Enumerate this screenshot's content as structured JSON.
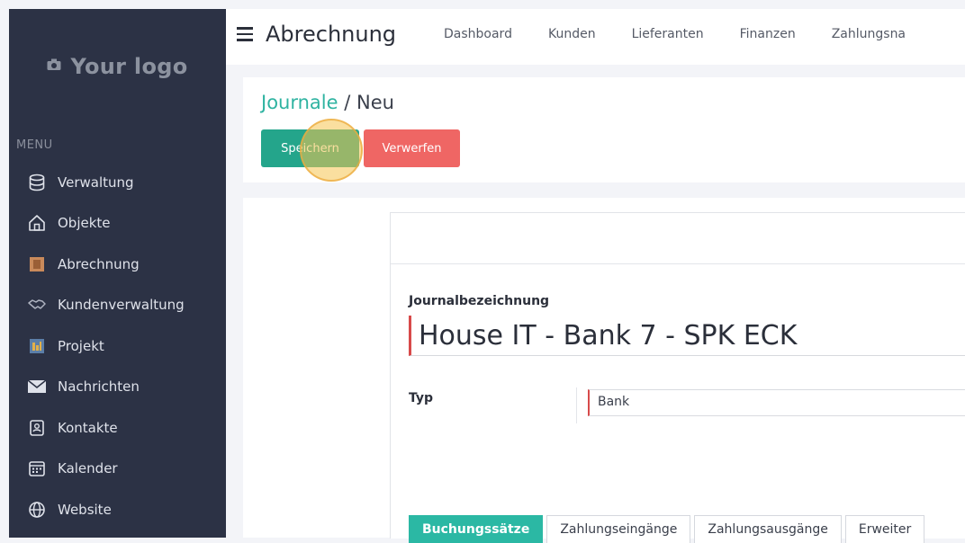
{
  "sidebar": {
    "logo_text": "Your logo",
    "menu_label": "MENU",
    "items": [
      {
        "label": "Verwaltung",
        "icon": "database-icon"
      },
      {
        "label": "Objekte",
        "icon": "house-icon"
      },
      {
        "label": "Abrechnung",
        "icon": "invoice-icon"
      },
      {
        "label": "Kundenverwaltung",
        "icon": "handshake-icon"
      },
      {
        "label": "Projekt",
        "icon": "project-icon"
      },
      {
        "label": "Nachrichten",
        "icon": "envelope-icon"
      },
      {
        "label": "Kontakte",
        "icon": "contact-card-icon"
      },
      {
        "label": "Kalender",
        "icon": "calendar-icon"
      },
      {
        "label": "Website",
        "icon": "globe-icon"
      }
    ]
  },
  "topbar": {
    "title": "Abrechnung",
    "nav": [
      "Dashboard",
      "Kunden",
      "Lieferanten",
      "Finanzen",
      "Zahlungsna"
    ]
  },
  "header": {
    "breadcrumb_link": "Journale",
    "breadcrumb_sep": " / ",
    "breadcrumb_current": "Neu",
    "save_label": "Speichern",
    "discard_label": "Verwerfen"
  },
  "form": {
    "name_label": "Journalbezeichnung",
    "name_value": "House IT - Bank 7 - SPK ECK",
    "type_label": "Typ",
    "type_value": "Bank",
    "tabs": [
      "Buchungssätze",
      "Zahlungseingänge",
      "Zahlungsausgänge",
      "Erweiter"
    ]
  },
  "colors": {
    "sidebar_bg": "#2c3245",
    "accent_teal": "#2bb8a4",
    "save_green": "#24a58b",
    "discard_red": "#ef6664"
  }
}
